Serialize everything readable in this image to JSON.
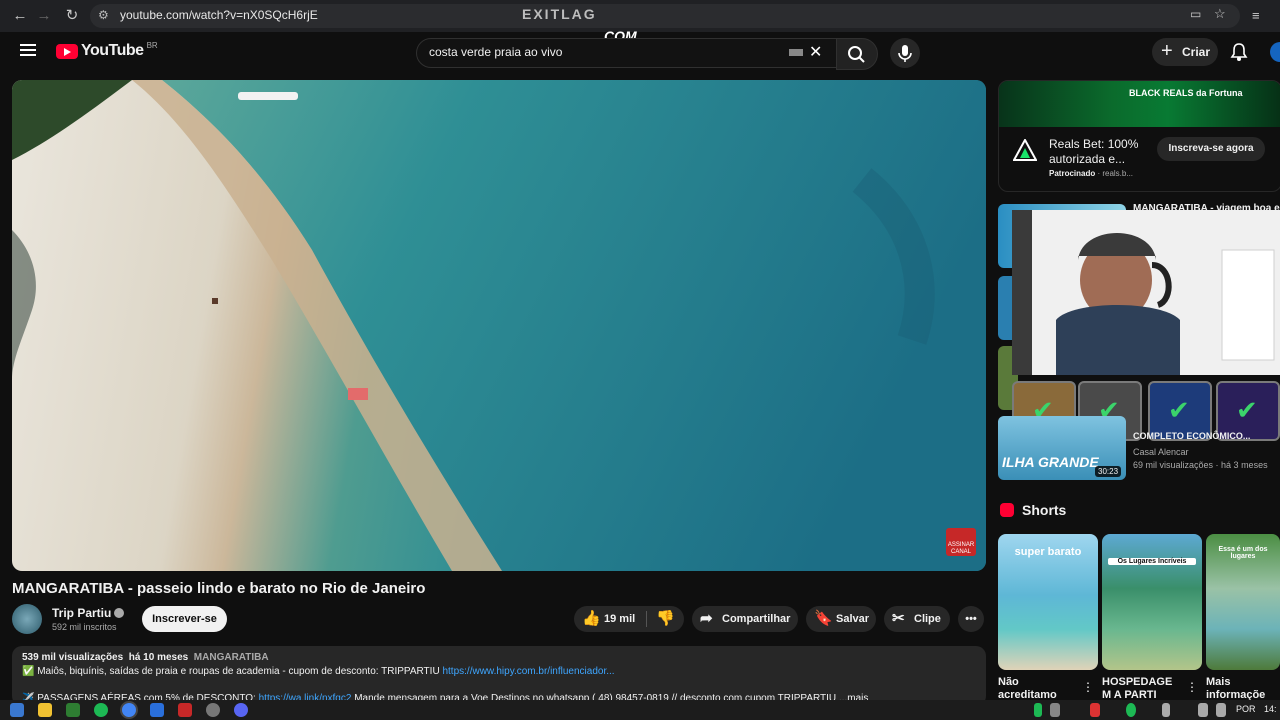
{
  "browser": {
    "url": "youtube.com/watch?v=nX0SQcH6rjE",
    "overlay_brand": "EXITLAG",
    "overlay_brand_2": "COM"
  },
  "header": {
    "logo_text": "YouTube",
    "region": "BR",
    "search_value": "costa verde praia ao vivo",
    "create_label": "Criar"
  },
  "video": {
    "watermark": "ASSINAR CANAL",
    "title": "MANGARATIBA - passeio lindo e barato no Rio de Janeiro",
    "channel": "Trip Partiu",
    "subscribers": "592 mil inscritos",
    "subscribe_label": "Inscrever-se",
    "likes": "19 mil",
    "share_label": "Compartilhar",
    "save_label": "Salvar",
    "clip_label": "Clipe",
    "more_icon": "more-horizontal-icon"
  },
  "description": {
    "views": "539 mil visualizações",
    "age": "há 10 meses",
    "tag": "MANGARATIBA",
    "line1": "✅ Maiôs, biquínis, saídas de praia e roupas de academia - cupom de desconto: TRIPPARTIU",
    "line1_link": "https://www.hipy.com.br/influenciador...",
    "line2": "✈️ PASSAGENS AÉREAS com 5% de DESCONTO:",
    "line2_link": "https://wa.link/nxfqc2",
    "line2_rest": "Mande mensagem para a Voe Destinos no whatsapp ( 48) 98457-0819 // desconto com cupom TRIPPARTIU",
    "more": "...mais"
  },
  "ad": {
    "banner_text": "BLACK REALS da Fortuna",
    "title": "Reals Bet: 100% autorizada e...",
    "sponsored": "Patrocinado",
    "domain": "reals.b...",
    "cta": "Inscreva-se agora"
  },
  "related": {
    "title1": "MANGARATIBA - viagem boa e",
    "title2": "COMPLETO ECONÔMICO...",
    "channel": "Casal Alencar",
    "views": "69 mil visualizações",
    "age": "há 3 meses",
    "duration": "30:23",
    "thumb_text": "ILHA GRANDE"
  },
  "shorts": {
    "heading": "Shorts",
    "items": [
      {
        "caption_1": "Não",
        "caption_2": "acreditamo",
        "thumb_text": "super barato"
      },
      {
        "caption_1": "HOSPEDAGE",
        "caption_2": "M A PARTI",
        "thumb_text": "Os Lugares Incríveis"
      },
      {
        "caption_1": "Mais",
        "caption_2": "informaçõe",
        "thumb_text": "Essa é um dos lugares"
      }
    ]
  },
  "taskbar": {
    "lang": "POR",
    "time": "14:"
  },
  "colors": {
    "brand_red": "#ff0033",
    "link": "#3ea6ff",
    "bg": "#0f0f0f"
  }
}
